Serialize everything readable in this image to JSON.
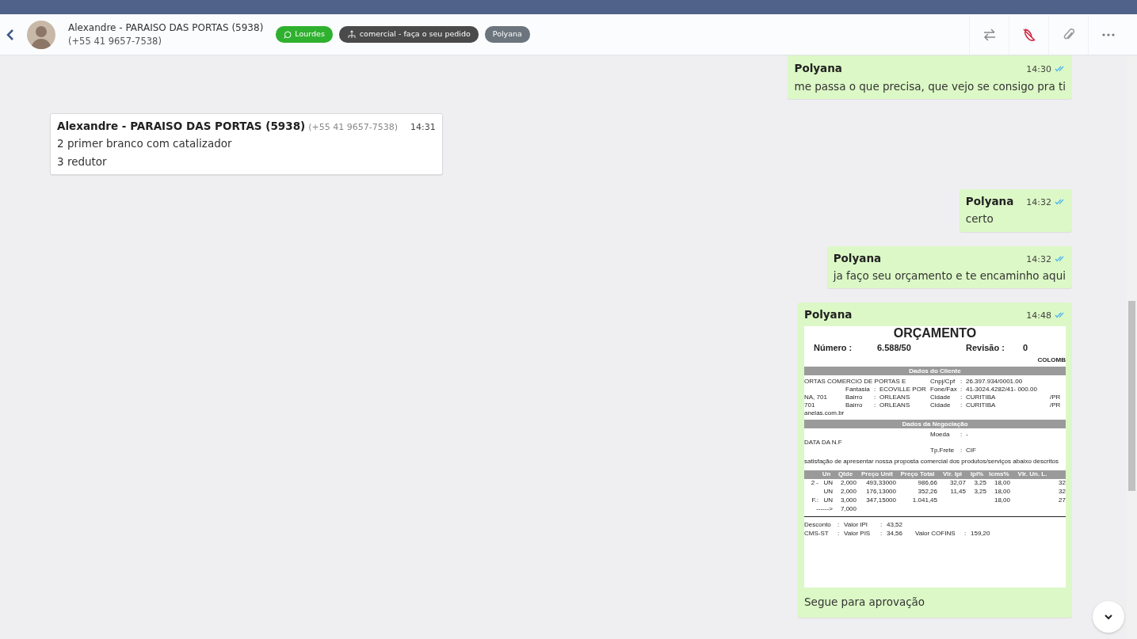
{
  "header": {
    "contact_name": "Alexandre - PARAISO DAS PORTAS (5938)",
    "contact_phone": "(+55 41 9657-7538)",
    "tags": [
      {
        "kind": "whatsapp",
        "label": "Lourdes",
        "color": "#2fb12f"
      },
      {
        "kind": "department",
        "label": "comercial - faça o seu pedido",
        "color": "#4a4a4a"
      },
      {
        "kind": "plain",
        "label": "Polyana",
        "color": "#6c757d"
      }
    ]
  },
  "messages": [
    {
      "outgoing": true,
      "sender": "Polyana",
      "time": "14:30",
      "read": true,
      "lines": [
        "me passa o que precisa, que vejo se consigo pra ti"
      ]
    },
    {
      "outgoing": false,
      "sender": "Alexandre - PARAISO DAS PORTAS (5938)",
      "phone": "(+55 41 9657-7538)",
      "time": "14:31",
      "lines": [
        "2 primer branco com catalizador",
        "3 redutor"
      ]
    },
    {
      "outgoing": true,
      "sender": "Polyana",
      "time": "14:32",
      "read": true,
      "lines": [
        "certo"
      ]
    },
    {
      "outgoing": true,
      "sender": "Polyana",
      "time": "14:32",
      "read": true,
      "lines": [
        "ja faço seu orçamento e te encaminho aqui"
      ]
    },
    {
      "outgoing": true,
      "sender": "Polyana",
      "time": "14:48",
      "read": true,
      "caption": "Segue para aprovação",
      "document": {
        "title": "ORÇAMENTO",
        "number_label": "Número :",
        "number": "6.588/50",
        "revision_label": "Revisão :",
        "revision": "0",
        "city": "COLOMB",
        "client_band": "Dados do Cliente",
        "client_rows": [
          {
            "name": "ORTAS COMERCIO DE PORTAS E",
            "label_2": "Cnpj/Cpf",
            "sep_2": ":",
            "value_2": "26.397.934/0001.00"
          },
          {
            "label_1": "Fantasia",
            "sep_1": ":",
            "value_1": "ECOVILLE POR",
            "label_2": "Fone/Fax",
            "sep_2": ":",
            "value_2": "41-3024.4282/41- 000.00"
          },
          {
            "name": "NA, 701",
            "label_1": "Bairro",
            "sep_1": ":",
            "value_1": "ORLEANS",
            "label_2": "Cidade",
            "sep_2": ":",
            "value_2": "CURITIBA",
            "state": "/PR"
          },
          {
            "name": "701",
            "label_1": "Bairro",
            "sep_1": ":",
            "value_1": "ORLEANS",
            "label_2": "Cidade",
            "sep_2": ":",
            "value_2": "CURITIBA",
            "state": "/PR"
          },
          {
            "name": "anelas.com.br"
          }
        ],
        "negotiation_band": "Dados da Negociação",
        "negotiation_rows": [
          {
            "label_2": "Moeda",
            "sep_2": ":",
            "value_2": "-"
          },
          {
            "name": "DATA DA N.F"
          },
          {
            "label_2": "Tp.Frete",
            "sep_2": ":",
            "value_2": "CIF"
          }
        ],
        "intro": "satisfação de apresentar nossa proposta comercial dos produtos/serviços abaixo descritos",
        "items_header": {
          "un": "Un",
          "qtde": "Qtde",
          "preco_unit": "Preço Unit",
          "preco_total": "Preço Total",
          "vlr_ipi": "Vlr. Ipi",
          "ipi_pct": "Ipi%",
          "icms_pct": "Icms%",
          "vlr_un_l": "Vlr. Un. L."
        },
        "items": [
          {
            "code": "2 -",
            "un": "UN",
            "qtde": "2,000",
            "preco_unit": "493,33000",
            "preco_total": "986,66",
            "vlr_ipi": "32,07",
            "ipi_pct": "3,25",
            "icms_pct": "18,00",
            "column_10": "32"
          },
          {
            "un": "UN",
            "qtde": "2,000",
            "preco_unit": "176,13000",
            "preco_total": "352,26",
            "vlr_ipi": "11,45",
            "ipi_pct": "3,25",
            "icms_pct": "18,00",
            "column_10": "32"
          },
          {
            "code": "F.:",
            "un": "UN",
            "qtde": "3,000",
            "preco_unit": "347,15000",
            "preco_total": "1.041,45",
            "icms_pct": "18,00",
            "column_10": "27"
          },
          {
            "code": "------>",
            "qtde": "7,000"
          }
        ],
        "totals": [
          {
            "label_1": "Desconto",
            "sep_1": ":",
            "label_2": "Valor IPI",
            "sep_2": ":",
            "value_2": "43,52"
          },
          {
            "label_1": "CMS-ST",
            "sep_1": ":",
            "label_2": "Valor PIS",
            "sep_2": ":",
            "value_2": "34,56",
            "label_3": "Valor COFINS",
            "sep_3": ":",
            "value_3": "159,20"
          }
        ]
      }
    }
  ]
}
